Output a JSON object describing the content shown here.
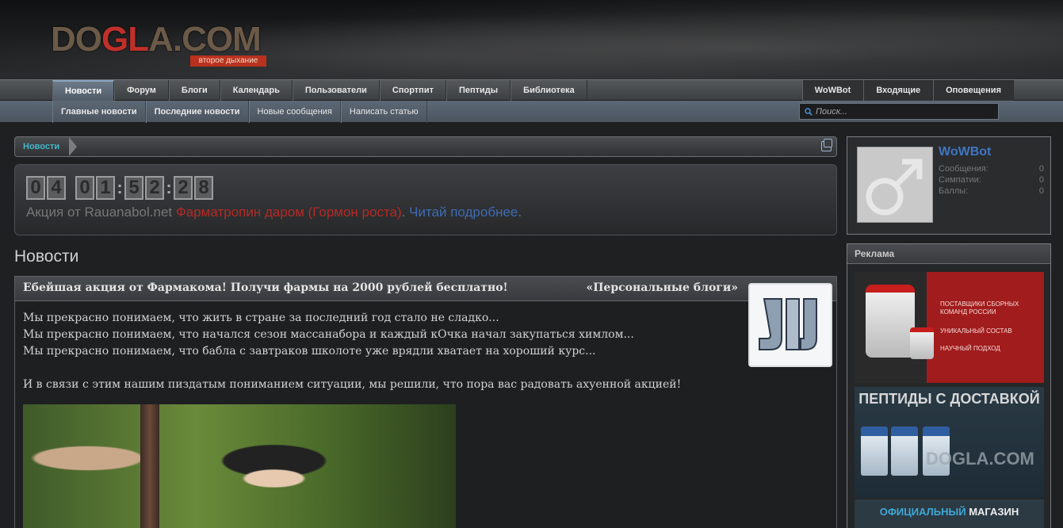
{
  "logo": {
    "text_left": "DO",
    "text_red": "GL",
    "text_right": "A.COM",
    "tagline": "второе дыхание"
  },
  "nav": {
    "main": [
      {
        "label": "Новости",
        "active": true
      },
      {
        "label": "Форум"
      },
      {
        "label": "Блоги"
      },
      {
        "label": "Календарь"
      },
      {
        "label": "Пользователи"
      },
      {
        "label": "Спортпит"
      },
      {
        "label": "Пептиды"
      },
      {
        "label": "Библиотека"
      }
    ],
    "right": [
      {
        "label": "WoWBot"
      },
      {
        "label": "Входящие"
      },
      {
        "label": "Оповещения"
      }
    ],
    "sub": [
      {
        "label": "Главные новости",
        "bold": true
      },
      {
        "label": "Последние новости",
        "bold": true
      },
      {
        "label": "Новые сообщения"
      },
      {
        "label": "Написать статью"
      }
    ]
  },
  "search": {
    "placeholder": "Поиск..."
  },
  "breadcrumb": {
    "current": "Новости"
  },
  "promo": {
    "timer_days": "04",
    "timer_hours": "01",
    "timer_minutes": "52",
    "timer_seconds": "28",
    "text_prefix": "Акция от Rauanabol.net ",
    "text_red": "Фарматропин даром (Гормон роста)",
    "text_sep": ". ",
    "text_link": "Читай подробнее",
    "text_end": "."
  },
  "page_title": "Новости",
  "article": {
    "title": "Ебейшая акция от Фармакома! Получи фармы на 2000 рублей бесплатно!",
    "category": "«Персональные блоги»",
    "lines": [
      "Мы прекрасно понимаем, что жить в стране за последний год стало не сладко...",
      "Мы прекрасно понимаем, что начался сезон массанабора и каждый кОчка начал закупаться химлом...",
      "Мы прекрасно понимаем, что бабла с завтраков школоте уже врядли хватает на хороший курс...",
      "",
      "И в связи с этим нашим пиздатым пониманием ситуации, мы решили, что пора вас радовать ахуенной акцией!"
    ]
  },
  "user": {
    "name": "WoWBot",
    "stats": [
      {
        "label": "Сообщения:",
        "value": "0"
      },
      {
        "label": "Симпатии:",
        "value": "0"
      },
      {
        "label": "Баллы:",
        "value": "0"
      }
    ]
  },
  "ads": {
    "heading": "Реклама",
    "ad1_lines": [
      "ПОСТАВЩИКИ СБОРНЫХ КОМАНД РОССИИ",
      "УНИКАЛЬНЫЙ СОСТАВ",
      "НАУЧНЫЙ ПОДХОД"
    ],
    "ad2_title": "ПЕПТИДЫ С ДОСТАВКОЙ",
    "ad2_brand": "DOGLA.COM",
    "ad3_blue": "ОФИЦИАЛЬНЫЙ",
    "ad3_white": "МАГАЗИН"
  },
  "colors": {
    "link_blue": "#3f76c4",
    "accent_red": "#b52a25",
    "breadcrumb_cyan": "#44b6c9"
  }
}
